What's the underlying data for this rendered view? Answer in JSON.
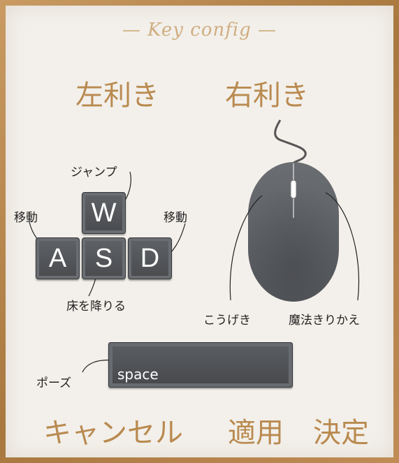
{
  "title": "— Key config —",
  "handedness": {
    "left": "左利き",
    "right": "右利き"
  },
  "keys": {
    "w": "W",
    "a": "A",
    "s": "S",
    "d": "D",
    "space": "space"
  },
  "labels": {
    "jump": "ジャンプ",
    "move_left": "移動",
    "move_right": "移動",
    "drop": "床を降りる",
    "attack": "こうげき",
    "magic_switch": "魔法きりかえ",
    "pause": "ポーズ"
  },
  "buttons": {
    "cancel": "キャンセル",
    "apply": "適用",
    "confirm": "決定"
  }
}
